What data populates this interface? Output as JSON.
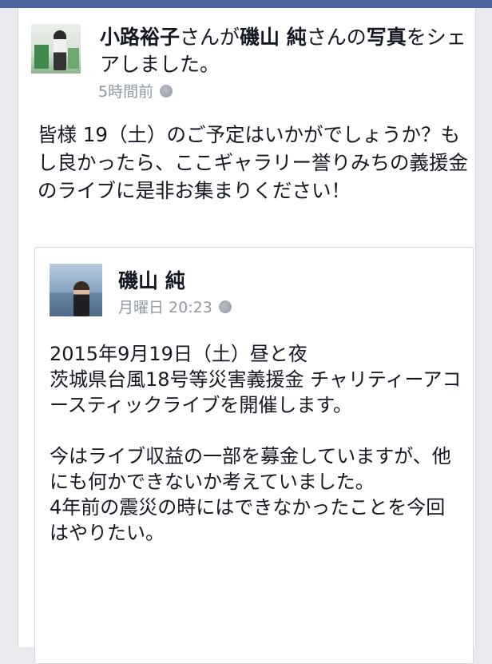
{
  "post": {
    "author": "小路裕子",
    "header_mid": "さんが",
    "shared_from": "磯山 純",
    "header_mid2": "さんの",
    "object": "写真",
    "header_end": "をシェアしました。",
    "time": "5時間前",
    "privacy_icon": "globe-icon",
    "message": "皆様 19（土）のご予定はいかがでしょうか？もし良かったら、ここギャラリー誉りみちの義援金のライブに是非お集まりください！"
  },
  "shared_post": {
    "author": "磯山 純",
    "time": "月曜日 20:23",
    "privacy_icon": "globe-icon",
    "paragraph1": "2015年9月19日（土）昼と夜\n茨城県台風18号等災害義援金 チャリティーアコースティックライブを開催します。",
    "paragraph2": "今はライブ収益の一部を募金していますが、他にも何かできないか考えていました。\n4年前の震災の時にはできなかったことを今回はやりたい。"
  },
  "colors": {
    "top_bar": "#4a64a0",
    "text": "#141823",
    "meta": "#9197a3",
    "background": "#e9eaee"
  }
}
